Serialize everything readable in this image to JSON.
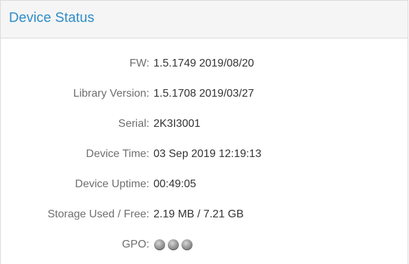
{
  "panel": {
    "title": "Device Status"
  },
  "rows": [
    {
      "label": "FW:",
      "value": "1.5.1749 2019/08/20"
    },
    {
      "label": "Library Version:",
      "value": "1.5.1708 2019/03/27"
    },
    {
      "label": "Serial:",
      "value": "2K3I3001"
    },
    {
      "label": "Device Time:",
      "value": "03 Sep 2019 12:19:13"
    },
    {
      "label": "Device Uptime:",
      "value": "00:49:05"
    },
    {
      "label": "Storage Used / Free:",
      "value": "2.19 MB / 7.21 GB"
    }
  ],
  "gpo": {
    "label": "GPO:",
    "indicators": [
      {
        "icon": "status-led-icon",
        "state": "off"
      },
      {
        "icon": "status-led-icon",
        "state": "off"
      },
      {
        "icon": "status-led-icon",
        "state": "off"
      }
    ]
  },
  "colors": {
    "title": "#2e8cc8",
    "label": "#6e6e6e",
    "value": "#333333",
    "header_bg": "#f5f5f5",
    "border": "#d9d9d9"
  }
}
